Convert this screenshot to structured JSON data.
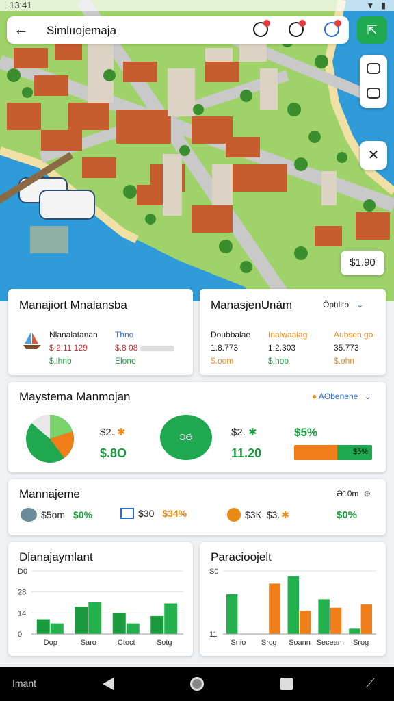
{
  "status_bar": {
    "time": "13:41",
    "icons": [
      "wifi-icon",
      "battery-icon"
    ]
  },
  "app_bar": {
    "title": "Simlııojemaja",
    "back_icon": "back-arrow-icon"
  },
  "map": {
    "price_badge": "$1.90"
  },
  "card_left_top": {
    "title": "Manajiort Mnalansba",
    "labels": [
      "Nlanalatanan",
      "$ 2.11 129",
      "$.lhno"
    ],
    "values": [
      "Thno",
      "$.8 08",
      "Elono"
    ]
  },
  "card_right_top": {
    "title": "ManasjenUnàm",
    "dropdown": "Ö̈ptılito",
    "columns": [
      {
        "header": "Doubbalae",
        "v1": "1.8.773",
        "v2": "$.oom"
      },
      {
        "header": "Inalwaalag",
        "v1": "1.2.303",
        "v2": "$.hoo"
      },
      {
        "header": "Aubsen go",
        "v1": "35.773",
        "v2": "$.ohn"
      }
    ]
  },
  "card_middle": {
    "title": "Maystema Manmojan",
    "dropdown": "AObenene",
    "pie_label_1": "$2.",
    "pie_value_1": "$.8O",
    "ring_label": "ЭӨ",
    "ring_amount": "$2.",
    "ring_value": "11.20",
    "percent": "$5%",
    "bar_label": "$5%",
    "bar_fill": 0.55
  },
  "card_stats": {
    "title": "Mannajeme",
    "right_label": "Ə10m",
    "items": [
      {
        "a": "$5om",
        "b": "$0%"
      },
      {
        "a": "$30",
        "b": "$34%"
      },
      {
        "a": "$3К",
        "b": "$3."
      },
      {
        "a": "",
        "b": "$0%"
      }
    ]
  },
  "chart_left": {
    "title": "Dlanajaymlant"
  },
  "chart_right": {
    "title": "Paracioojelt"
  },
  "chart_data": [
    {
      "type": "bar",
      "title": "Dlanajaymlant",
      "categories": [
        "Dop",
        "Saro",
        "Ctoct",
        "Sotg"
      ],
      "yticks": [
        "0",
        "14",
        "28",
        "D0"
      ],
      "series": [
        {
          "values": [
            14,
            26,
            20,
            17
          ],
          "color": "#1a9c3e"
        },
        {
          "values": [
            10,
            30,
            10,
            29
          ],
          "color": "#22b14c"
        }
      ]
    },
    {
      "type": "bar",
      "title": "Paracioojelt",
      "categories": [
        "Snio",
        "Srcg",
        "Soann",
        "Seceam",
        "Srog"
      ],
      "yticks": [
        "11",
        "S0"
      ],
      "series": [
        {
          "values": [
            38,
            0,
            55,
            33,
            5
          ],
          "color": "#22b14c"
        },
        {
          "values": [
            0,
            48,
            22,
            25,
            28
          ],
          "color": "#f07f1a"
        }
      ]
    }
  ],
  "nav": {
    "label": "Imant"
  }
}
